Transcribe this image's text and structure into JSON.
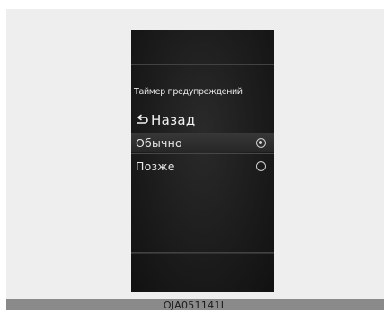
{
  "screen": {
    "title": "Таймер предупреждений",
    "back": {
      "icon": "back-arrow-icon",
      "label": "Назад"
    },
    "options": [
      {
        "label": "Обычно",
        "selected": true
      },
      {
        "label": "Позже",
        "selected": false
      }
    ]
  },
  "caption": "OJA051141L",
  "colors": {
    "screen_background": "#1c1c1c",
    "text": "#e8e8e8",
    "page_background": "#eeeeee",
    "caption_bar": "#8a8a8a"
  }
}
